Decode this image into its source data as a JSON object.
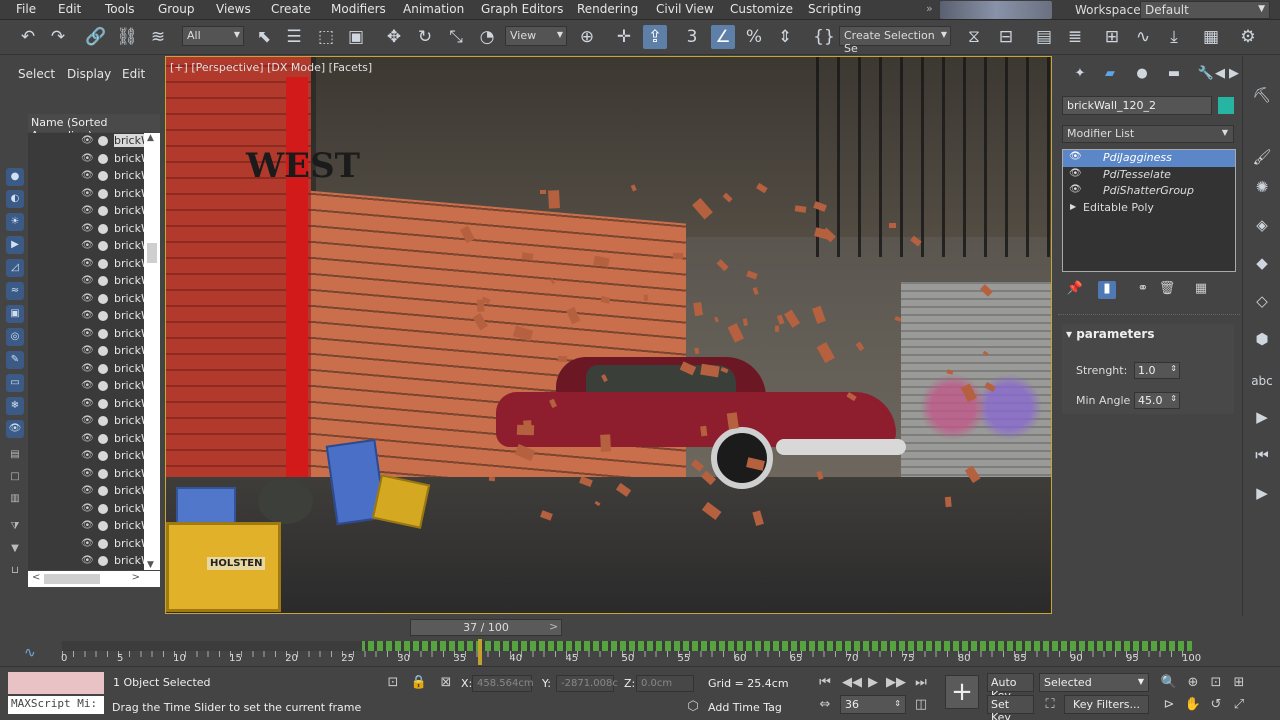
{
  "menubar": {
    "items": [
      "File",
      "Edit",
      "Tools",
      "Group",
      "Views",
      "Create",
      "Modifiers",
      "Animation",
      "Graph Editors",
      "Rendering",
      "Civil View",
      "Customize",
      "Scripting"
    ],
    "more": "»",
    "workspaces_label": "Workspaces:",
    "workspaces_value": "Default"
  },
  "toolbar": {
    "filter_value": "All",
    "refcoord_value": "View",
    "selection_set_placeholder": "Create Selection Se"
  },
  "scene_explorer": {
    "menu": [
      "Select",
      "Display",
      "Edit"
    ],
    "column_header": "Name (Sorted Ascending)",
    "rows": [
      "brickW",
      "brickW",
      "brickW",
      "brickW",
      "brickW",
      "brickW",
      "brickW",
      "brickW",
      "brickW",
      "brickW",
      "brickW",
      "brickW",
      "brickW",
      "brickW",
      "brickW",
      "brickW",
      "brickW",
      "brickW",
      "brickW",
      "brickW",
      "brickW",
      "brickW",
      "brickW",
      "brickW",
      "brickW"
    ],
    "selected_index": 0
  },
  "viewport": {
    "label_plus": "[+]",
    "label_view": "[Perspective]",
    "label_mode": "[DX Mode]",
    "label_shading": "[Facets]",
    "graffiti_text": "WEST",
    "crate_label": "HOLSTEN"
  },
  "command_panel": {
    "object_name": "brickWall_120_2",
    "object_color": "#26b5a3",
    "modifier_list_label": "Modifier List",
    "stack": [
      {
        "label": "PdiJagginess",
        "selected": true
      },
      {
        "label": "PdiTesselate",
        "selected": false
      },
      {
        "label": "PdiShatterGroup",
        "selected": false
      },
      {
        "label": "Editable Poly",
        "selected": false,
        "base": true
      }
    ],
    "rollout_title": "parameters",
    "params": [
      {
        "label": "Strenght:",
        "value": "1.0"
      },
      {
        "label": "Min Angle",
        "value": "45.0"
      }
    ]
  },
  "timeline": {
    "frame_label": "37 / 100",
    "current_frame": 37,
    "total_frames": 100,
    "ticks": [
      "0",
      "5",
      "10",
      "15",
      "20",
      "25",
      "30",
      "35",
      "40",
      "45",
      "50",
      "55",
      "60",
      "65",
      "70",
      "75",
      "80",
      "85",
      "90",
      "95",
      "100"
    ]
  },
  "statusbar": {
    "maxscript_text": "MAXScript Mi:",
    "selection_status": "1 Object Selected",
    "prompt": "Drag the Time Slider to set the current frame",
    "x_label": "X:",
    "x_value": "458.564cm",
    "y_label": "Y:",
    "y_value": "-2871.008c",
    "z_label": "Z:",
    "z_value": "0.0cm",
    "grid": "Grid = 25.4cm",
    "add_time_tag": "Add Time Tag",
    "auto_key": "Auto Key",
    "set_key": "Set Key",
    "selected_dropdown": "Selected",
    "key_filters": "Key Filters...",
    "frame_spinner": "36"
  }
}
